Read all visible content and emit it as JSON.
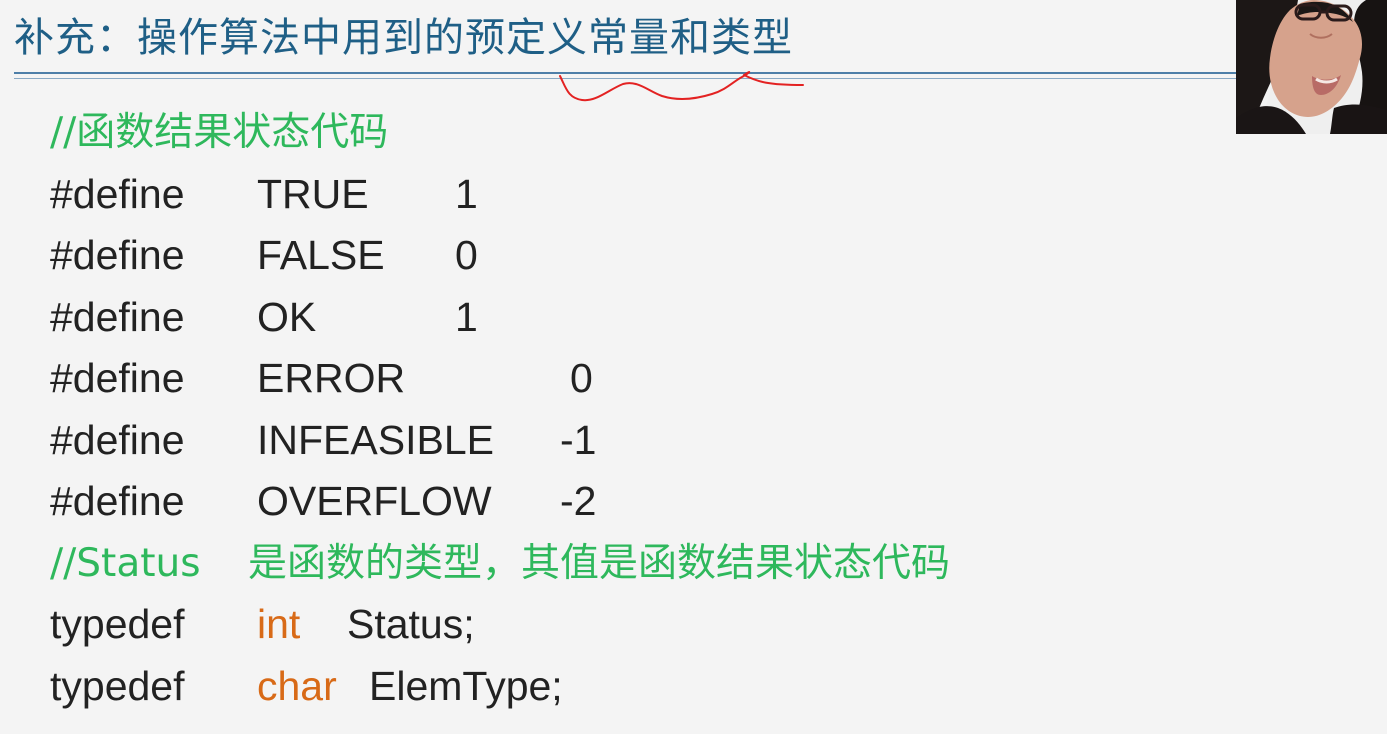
{
  "slide": {
    "title": "补充：操作算法中用到的预定义常量和类型"
  },
  "code": {
    "comment_status_codes": "//函数结果状态代码",
    "defines": [
      {
        "directive": "#define",
        "name": "TRUE",
        "value": "1"
      },
      {
        "directive": "#define",
        "name": "FALSE",
        "value": "0"
      },
      {
        "directive": "#define",
        "name": "OK",
        "value": "1"
      },
      {
        "directive": "#define",
        "name": "ERROR",
        "value": "0"
      },
      {
        "directive": "#define",
        "name": "INFEASIBLE",
        "value": "-1"
      },
      {
        "directive": "#define",
        "name": "OVERFLOW",
        "value": "-2"
      }
    ],
    "comment_status_type_prefix": "//Status",
    "comment_status_type_suffix": "是函数的类型，其值是函数结果状态代码",
    "typedefs": [
      {
        "keyword": "typedef",
        "type": "int",
        "name": "Status;"
      },
      {
        "keyword": "typedef",
        "type": "char",
        "name": "ElemType;"
      }
    ]
  },
  "colors": {
    "title": "#1f5f86",
    "comment": "#2eb85c",
    "keyword": "#d86a17",
    "annotation": "#e32222"
  }
}
